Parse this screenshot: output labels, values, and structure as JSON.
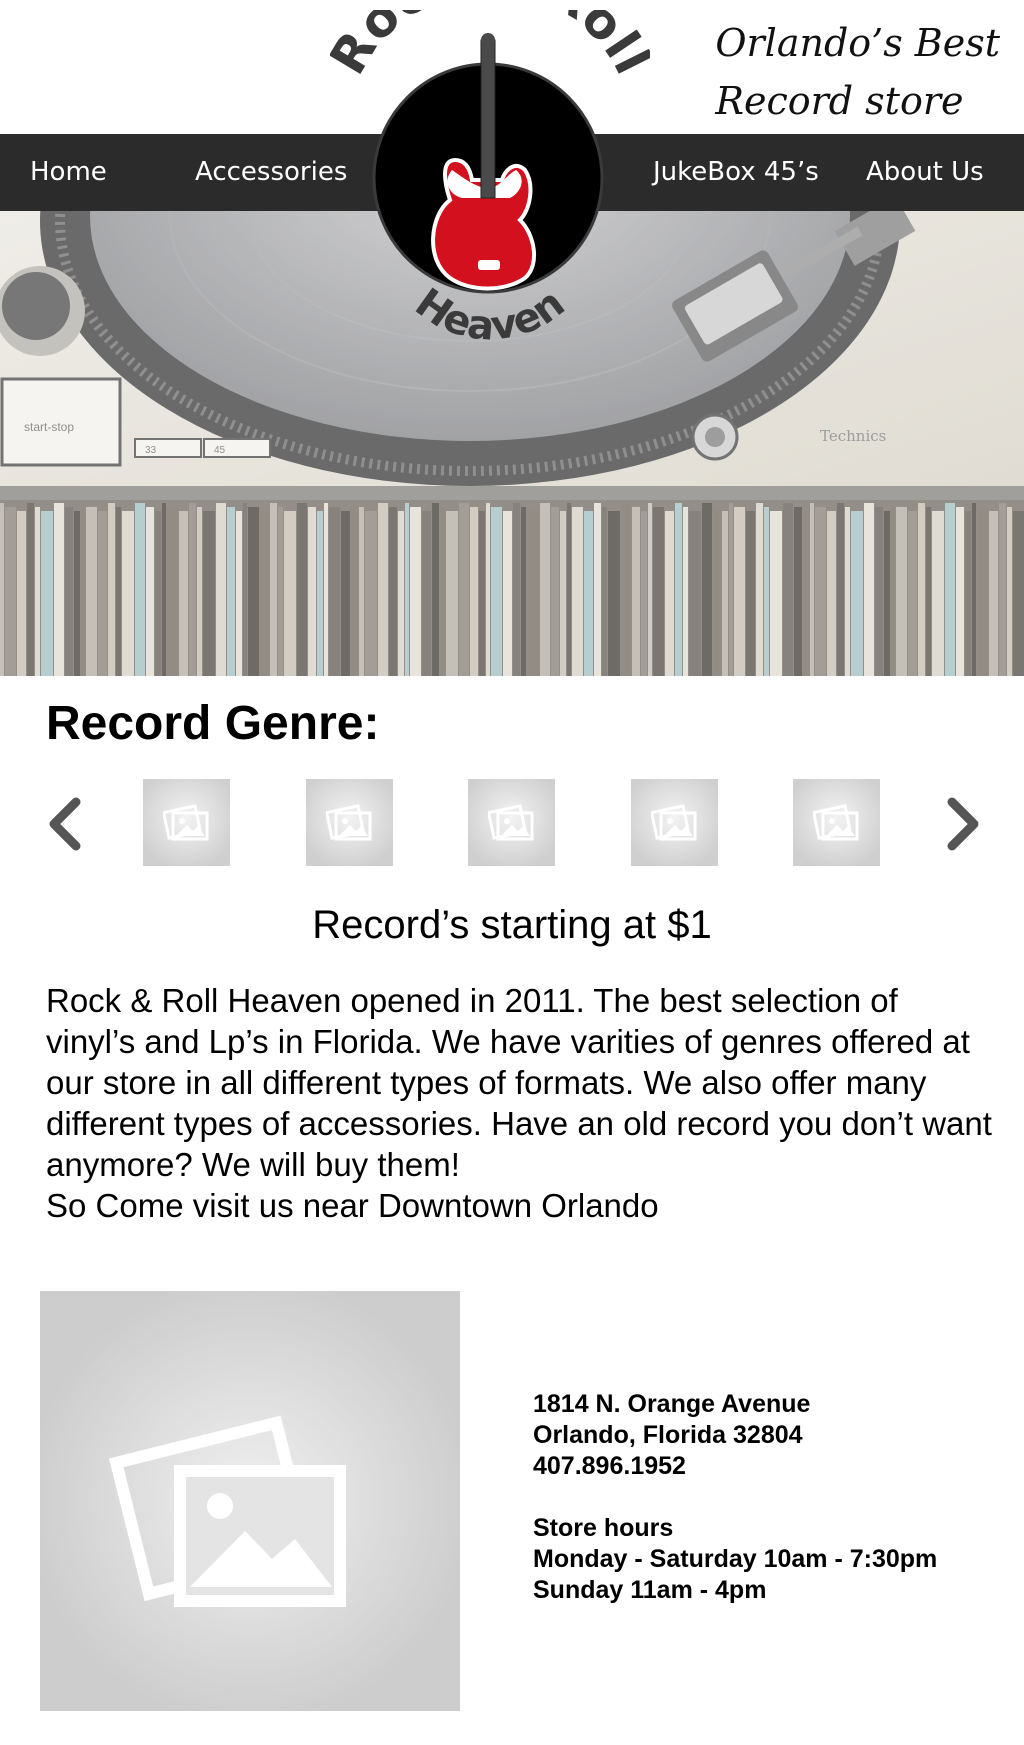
{
  "header": {
    "tagline_line1": "Orlando’s Best",
    "tagline_line2": "Record store"
  },
  "logo": {
    "arc_top": "Rock & Roll",
    "arc_bottom": "Heaven"
  },
  "nav": {
    "items": [
      {
        "label": "Home"
      },
      {
        "label": "Accessories"
      },
      {
        "label": "JukeBox 45’s"
      },
      {
        "label": "About Us"
      }
    ]
  },
  "hero": {
    "turntable_label": "start-stop",
    "speed_33": "33",
    "speed_45": "45",
    "brand": "Technics"
  },
  "genre": {
    "title": "Record Genre:",
    "prev_icon": "chevron-left-icon",
    "next_icon": "chevron-right-icon",
    "thumbnail_icon": "image-placeholder-icon"
  },
  "price": "Record’s starting at $1",
  "about": {
    "lines": [
      "Rock & Roll Heaven opened in 2011. The best selection of",
      "vinyl’s and Lp’s in Florida.  We have varities of genres offered at",
      "our store in all different types of formats. We also offer many",
      "different types of accessories. Have an old record you don’t want",
      "anymore? We will buy them!",
      "So Come visit us near Downtown Orlando"
    ]
  },
  "contact": {
    "address_line1": "1814 N. Orange Avenue",
    "address_line2": "Orlando, Florida 32804",
    "phone": "407.896.1952",
    "hours_title": "Store hours",
    "hours_weekday": "Monday - Saturday 10am - 7:30pm",
    "hours_sunday": "Sunday 11am - 4pm"
  },
  "colors": {
    "nav_bg": "#2b2b2b",
    "guitar_red": "#d3101d",
    "placeholder_gray": "#cfcfcf"
  }
}
